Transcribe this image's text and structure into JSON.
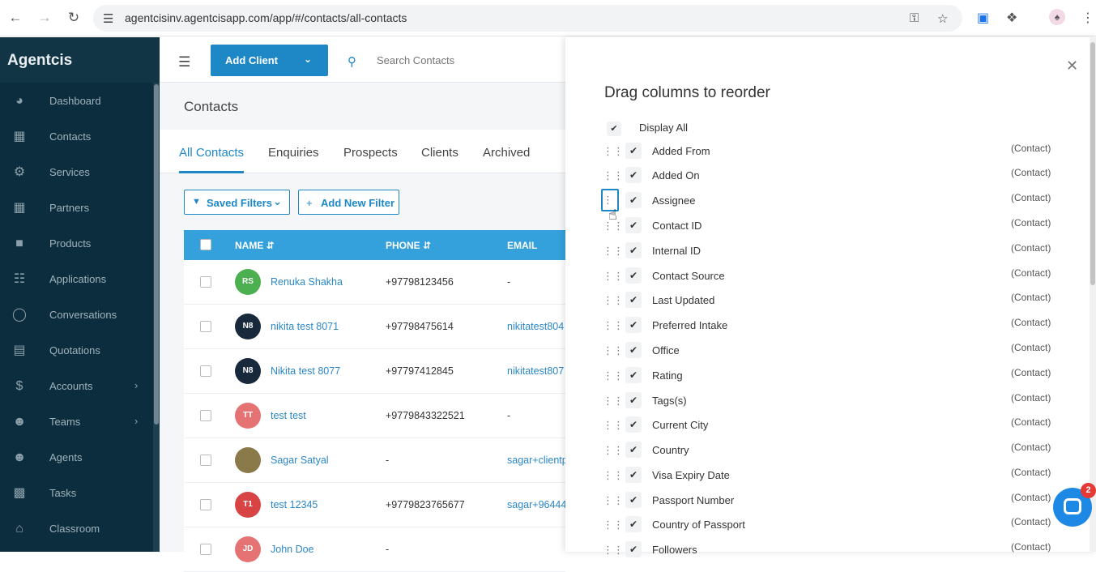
{
  "browser": {
    "url": "agentcisinv.agentcisapp.com/app/#/contacts/all-contacts"
  },
  "sidebar": {
    "brand": "Agentcis",
    "items": [
      {
        "label": "Dashboard",
        "icon": "gauge-icon"
      },
      {
        "label": "Contacts",
        "icon": "contact-card-icon"
      },
      {
        "label": "Services",
        "icon": "services-icon"
      },
      {
        "label": "Partners",
        "icon": "building-icon"
      },
      {
        "label": "Products",
        "icon": "products-icon"
      },
      {
        "label": "Applications",
        "icon": "flow-icon"
      },
      {
        "label": "Conversations",
        "icon": "chat-icon"
      },
      {
        "label": "Quotations",
        "icon": "document-icon"
      },
      {
        "label": "Accounts",
        "icon": "dollar-icon"
      },
      {
        "label": "Teams",
        "icon": "team-icon"
      },
      {
        "label": "Agents",
        "icon": "agents-icon"
      },
      {
        "label": "Tasks",
        "icon": "briefcase-icon"
      },
      {
        "label": "Classroom",
        "icon": "home-icon"
      }
    ]
  },
  "topbar": {
    "add_client": "Add Client",
    "search_placeholder": "Search Contacts"
  },
  "page": {
    "title": "Contacts",
    "tabs": [
      "All Contacts",
      "Enquiries",
      "Prospects",
      "Clients",
      "Archived"
    ],
    "saved_filters": "Saved Filters",
    "add_filter": "Add New Filter"
  },
  "table": {
    "headers": {
      "name": "NAME",
      "phone": "PHONE",
      "email": "EMAIL"
    },
    "rows": [
      {
        "initials": "RS",
        "name": "Renuka Shakha",
        "phone": "+97798123456",
        "email": "-",
        "color": "#4caf50"
      },
      {
        "initials": "N8",
        "name": "nikita test 8071",
        "phone": "+97798475614",
        "email": "nikitatest804",
        "color": "#17293a"
      },
      {
        "initials": "N8",
        "name": "Nikita test 8077",
        "phone": "+97797412845",
        "email": "nikitatest807",
        "color": "#17293a"
      },
      {
        "initials": "TT",
        "name": "test test",
        "phone": "+9779843322521",
        "email": "-",
        "color": "#e57373"
      },
      {
        "initials": "",
        "name": "Sagar Satyal",
        "phone": "-",
        "email": "sagar+clientp",
        "color": "#8a7a4a"
      },
      {
        "initials": "T1",
        "name": "test 12345",
        "phone": "+9779823765677",
        "email": "sagar+96444",
        "color": "#d84343"
      },
      {
        "initials": "JD",
        "name": "John Doe",
        "phone": "-",
        "email": "",
        "color": "#e57373"
      }
    ]
  },
  "drawer": {
    "title": "Drag columns to reorder",
    "display_all": "Display All",
    "columns": [
      {
        "label": "Added From",
        "tag": "(Contact)"
      },
      {
        "label": "Added On",
        "tag": "(Contact)"
      },
      {
        "label": "Assignee",
        "tag": "(Contact)"
      },
      {
        "label": "Contact ID",
        "tag": "(Contact)"
      },
      {
        "label": "Internal ID",
        "tag": "(Contact)"
      },
      {
        "label": "Contact Source",
        "tag": "(Contact)"
      },
      {
        "label": "Last Updated",
        "tag": "(Contact)"
      },
      {
        "label": "Preferred Intake",
        "tag": "(Contact)"
      },
      {
        "label": "Office",
        "tag": "(Contact)"
      },
      {
        "label": "Rating",
        "tag": "(Contact)"
      },
      {
        "label": "Tags(s)",
        "tag": "(Contact)"
      },
      {
        "label": "Current City",
        "tag": "(Contact)"
      },
      {
        "label": "Country",
        "tag": "(Contact)"
      },
      {
        "label": "Visa Expiry Date",
        "tag": "(Contact)"
      },
      {
        "label": "Passport Number",
        "tag": "(Contact)"
      },
      {
        "label": "Country of Passport",
        "tag": "(Contact)"
      },
      {
        "label": "Followers",
        "tag": "(Contact)"
      }
    ]
  },
  "chat": {
    "badge": "2"
  },
  "colors": {
    "accent": "#1e88c7",
    "sidebar": "#0c2d3d",
    "table_header": "#34a0dc"
  }
}
